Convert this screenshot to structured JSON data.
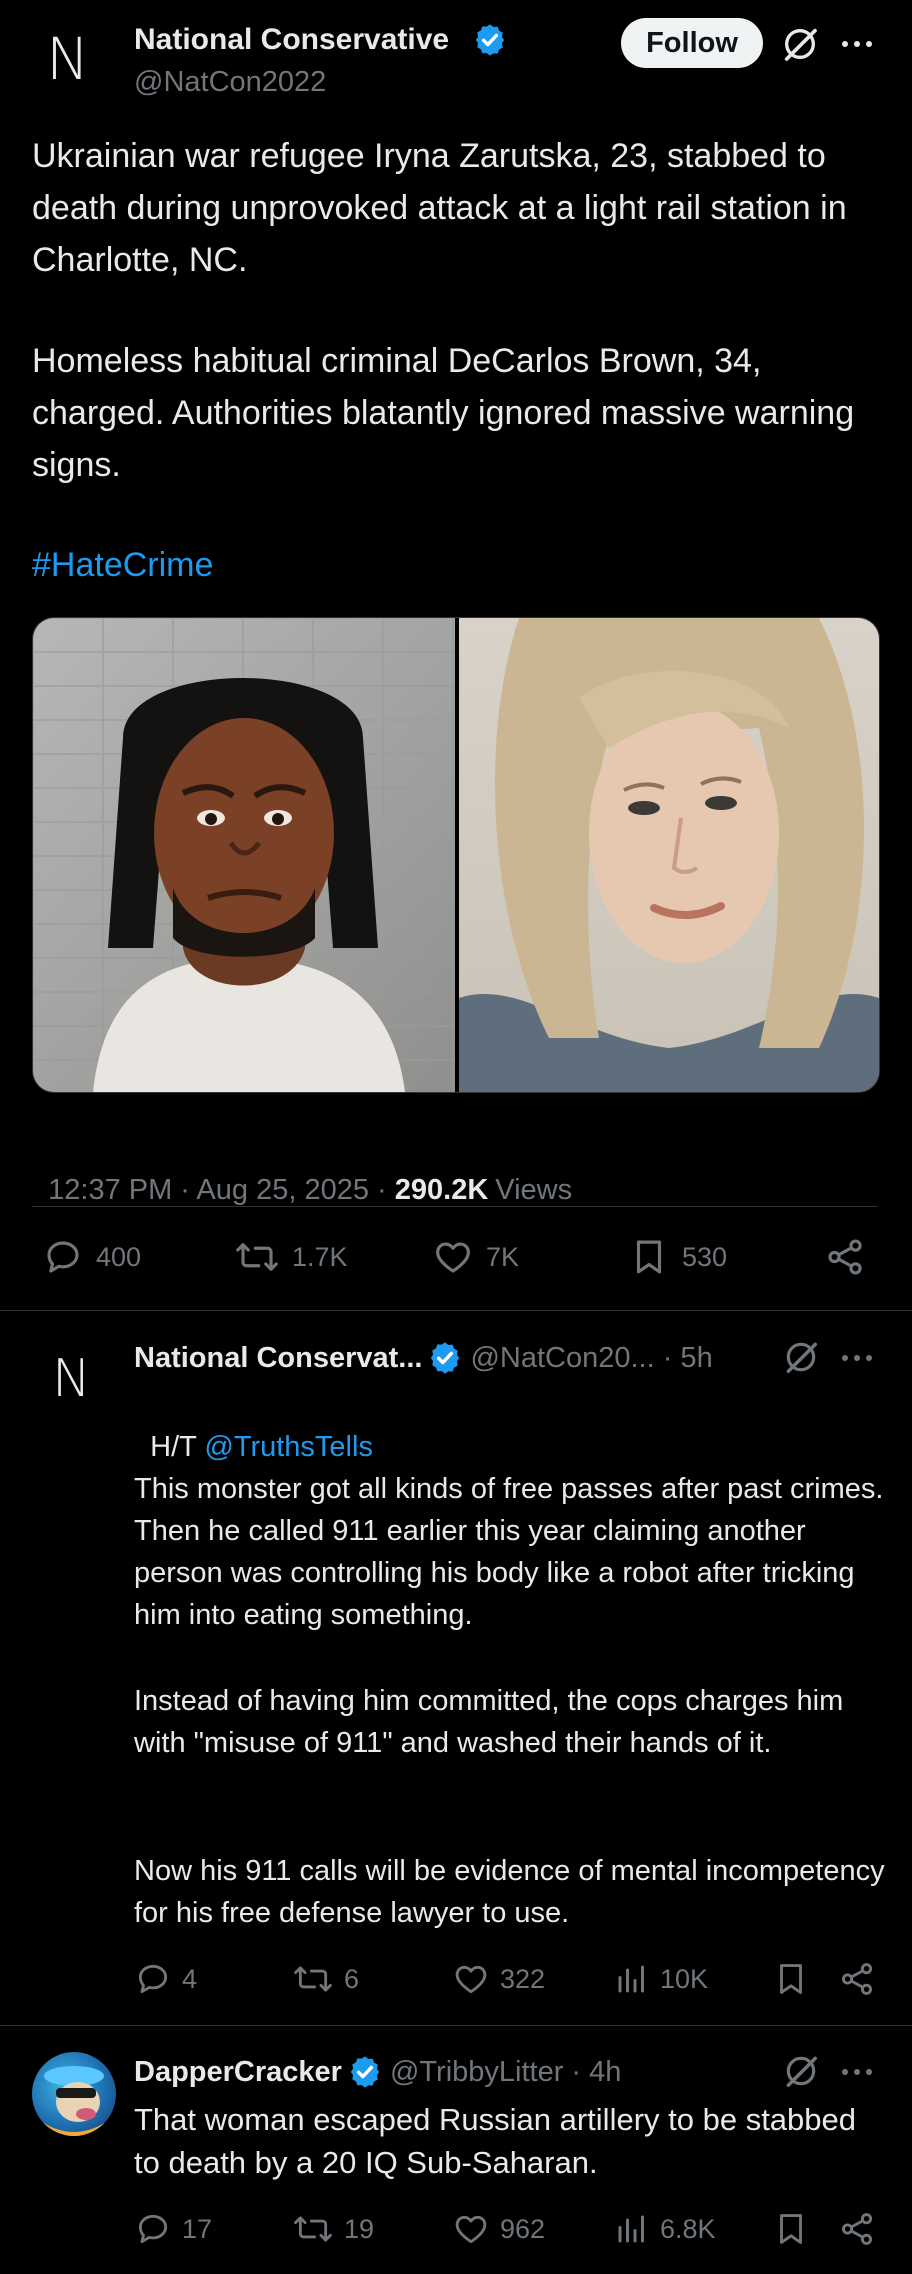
{
  "main_post": {
    "author_name": "National Conservative",
    "handle": "@NatCon2022",
    "follow_label": "Follow",
    "paragraph1": "Ukrainian war refugee Iryna Zarutska, 23, stabbed to death during unprovoked attack at a light rail station in Charlotte, NC.",
    "paragraph2": "Homeless habitual criminal DeCarlos Brown, 34, charged. Authorities blatantly ignored massive warning signs.",
    "hashtag": "#HateCrime",
    "timestamp": "12:37 PM · Aug 25, 2025 · ",
    "views_count": "290.2K",
    "views_label": "Views",
    "replies": "400",
    "reposts": "1.7K",
    "likes": "7K",
    "bookmarks": "530"
  },
  "reply1": {
    "author_name": "National Conservat...",
    "handle_time": "@NatCon20... · 5h",
    "ht_prefix": "H/T ",
    "ht_mention": "@TruthsTells",
    "paragraph1": "This monster got all kinds of free passes after past crimes. Then he called 911 earlier this year claiming another person was controlling his body like a robot after tricking him into eating something.",
    "paragraph2": "Instead of having him committed, the cops charges him with \"misuse of 911\" and washed their hands of it.",
    "paragraph3": "Now his 911 calls will be evidence of mental incompetency for his free defense lawyer to use.",
    "replies": "4",
    "reposts": "6",
    "likes": "322",
    "views": "10K"
  },
  "reply2": {
    "author_name": "DapperCracker",
    "handle_time": "@TribbyLitter · 4h",
    "text": "That woman escaped Russian artillery to be stabbed to death by a 20 IQ Sub-Saharan.",
    "replies": "17",
    "reposts": "19",
    "likes": "962",
    "views": "6.8K"
  },
  "icons": [
    "natcon-logo-icon",
    "verified-badge-icon",
    "grok-icon",
    "more-icon",
    "reply-icon",
    "repost-icon",
    "like-icon",
    "bookmark-icon",
    "share-icon",
    "views-icon"
  ],
  "colors": {
    "background": "#000000",
    "text": "#e7e9ea",
    "muted": "#71767b",
    "link": "#1d9bf0",
    "verified": "#1d9bf0",
    "divider": "#2f3336"
  }
}
